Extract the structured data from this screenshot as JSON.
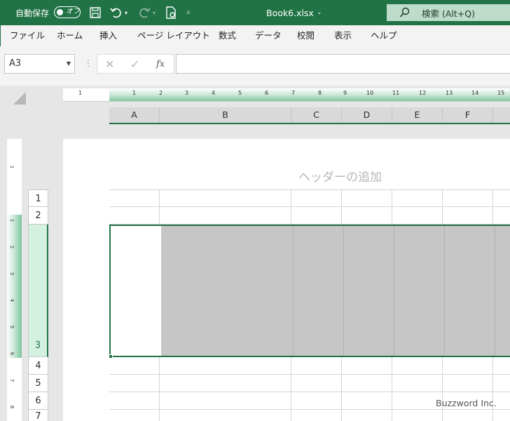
{
  "titlebar": {
    "autosave_label": "自動保存",
    "toggle_state": "オフ",
    "filename": "Book6.xlsx",
    "search_label": "検索 (Alt+Q)"
  },
  "ribbon": {
    "tabs": [
      "ファイル",
      "ホーム",
      "挿入",
      "ページ レイアウト",
      "数式",
      "データ",
      "校閲",
      "表示",
      "ヘルプ"
    ]
  },
  "formula_bar": {
    "name_box": "A3",
    "cancel_icon": "✕",
    "enter_icon": "✓",
    "fx_label": "fx",
    "formula_value": ""
  },
  "ruler": {
    "horizontal_ticks": [
      "1",
      "1",
      "2",
      "3",
      "4",
      "5",
      "6",
      "7",
      "8",
      "9",
      "10",
      "11",
      "12",
      "13",
      "14",
      "15"
    ],
    "vertical_ticks": [
      "1",
      "1",
      "2",
      "3",
      "4",
      "5",
      "6",
      "7",
      "8"
    ]
  },
  "sheet": {
    "columns": [
      "A",
      "B",
      "C",
      "D",
      "E",
      "F"
    ],
    "header_placeholder": "ヘッダーの追加",
    "row_headers": [
      "1",
      "2",
      "3",
      "4",
      "5",
      "6",
      "7"
    ],
    "selected_row": "3",
    "active_cell": "A3"
  },
  "watermark": "Buzzword Inc.",
  "colors": {
    "accent": "#217346",
    "selection_fill": "#c6c6c6",
    "header_highlight": "#d3f0e0"
  }
}
